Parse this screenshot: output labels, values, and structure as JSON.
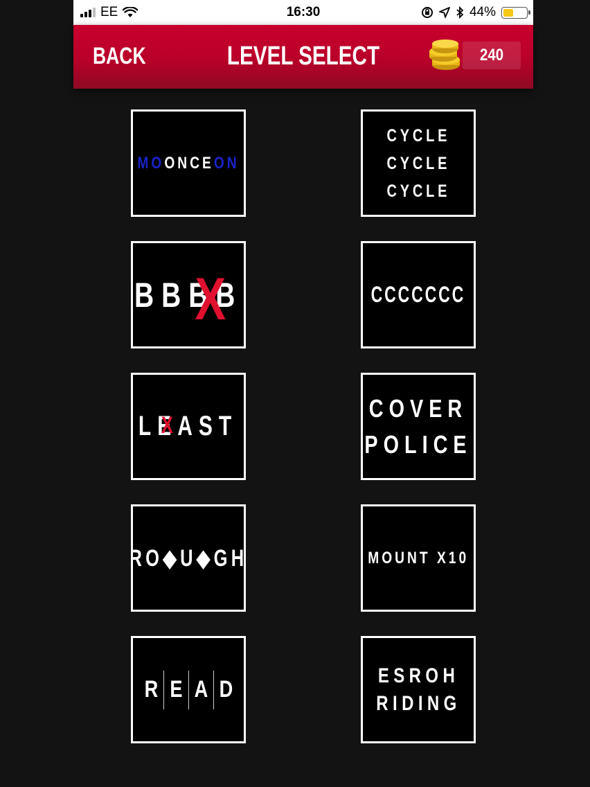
{
  "status_bar": {
    "carrier": "EE",
    "time": "16:30",
    "battery_percent": "44%",
    "battery_level": 0.44,
    "icons": [
      "signal-icon",
      "wifi-icon",
      "orientation-lock-icon",
      "location-icon",
      "bluetooth-icon",
      "battery-icon"
    ]
  },
  "header": {
    "back_label": "BACK",
    "title": "LEVEL SELECT",
    "coins": "240",
    "coin_icon": "coins-icon"
  },
  "colors": {
    "header_top": "#c8002c",
    "header_bottom": "#8e0a23",
    "background": "#141314",
    "tile_border": "#ffffff",
    "accent_red": "#e0102f",
    "accent_blue": "#1a23c8",
    "coin_gold": "#f2c21b"
  },
  "levels": {
    "moonceon": {
      "pre": "MO",
      "mid": "ONCE",
      "post": "ON"
    },
    "cycle": {
      "lines": [
        "CYCLE",
        "CYCLE",
        "CYCLE"
      ]
    },
    "bbbb": {
      "text": "BBBB",
      "mark": "X"
    },
    "cccc": {
      "text": "CCCCCCC"
    },
    "least": {
      "text": "LEAST",
      "mark": "X"
    },
    "cover": {
      "lines": [
        "COVER",
        "POLICE"
      ]
    },
    "rough": {
      "a": "RO",
      "diamond1": "◆",
      "b": "U",
      "diamond2": "◆",
      "c": "GH"
    },
    "mount": {
      "text": "MOUNT X10"
    },
    "read": {
      "letters": [
        "R",
        "E",
        "A",
        "D"
      ]
    },
    "esroh": {
      "lines": [
        "ESROH",
        "RIDING"
      ]
    }
  }
}
